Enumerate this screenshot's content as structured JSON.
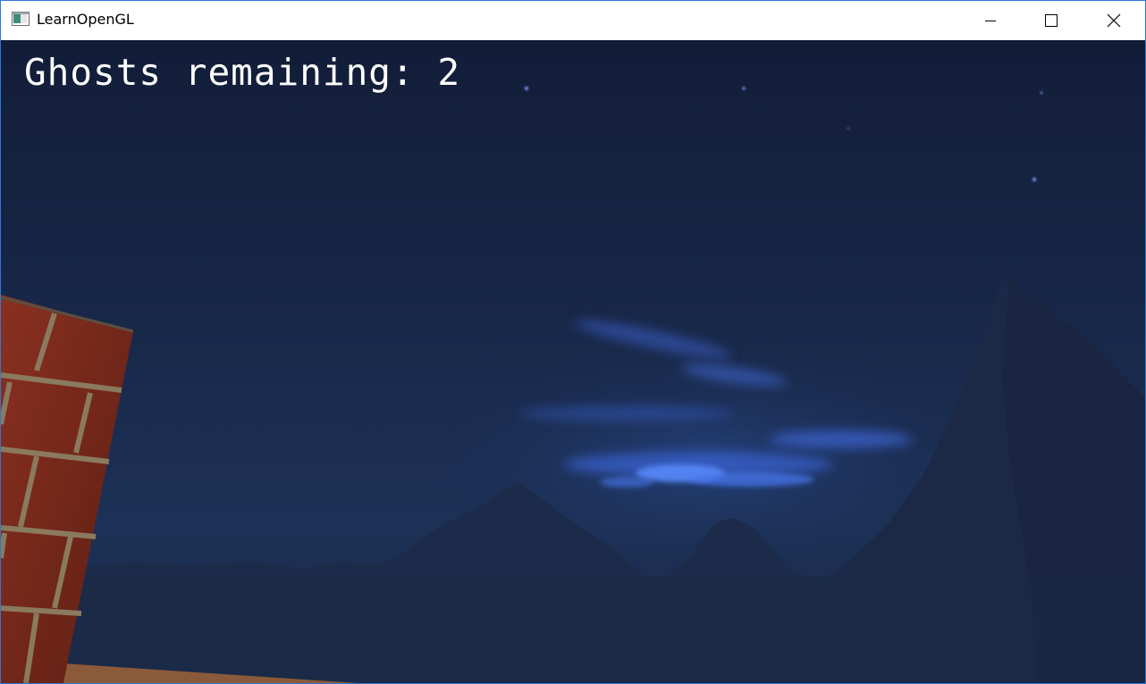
{
  "window": {
    "title": "LearnOpenGL",
    "icon": "app-window-icon",
    "controls": [
      "minimize-icon",
      "maximize-icon",
      "close-icon"
    ],
    "accent_color": "#2b78d6"
  },
  "game": {
    "hud_text": "Ghosts remaining: 2",
    "sky_color": "#15223f",
    "nebula_color": "#3f6fe6",
    "mountain_color": "#1d2d4d",
    "brick_color": "#7a2a1c",
    "mortar_color": "#8a7a5e"
  }
}
